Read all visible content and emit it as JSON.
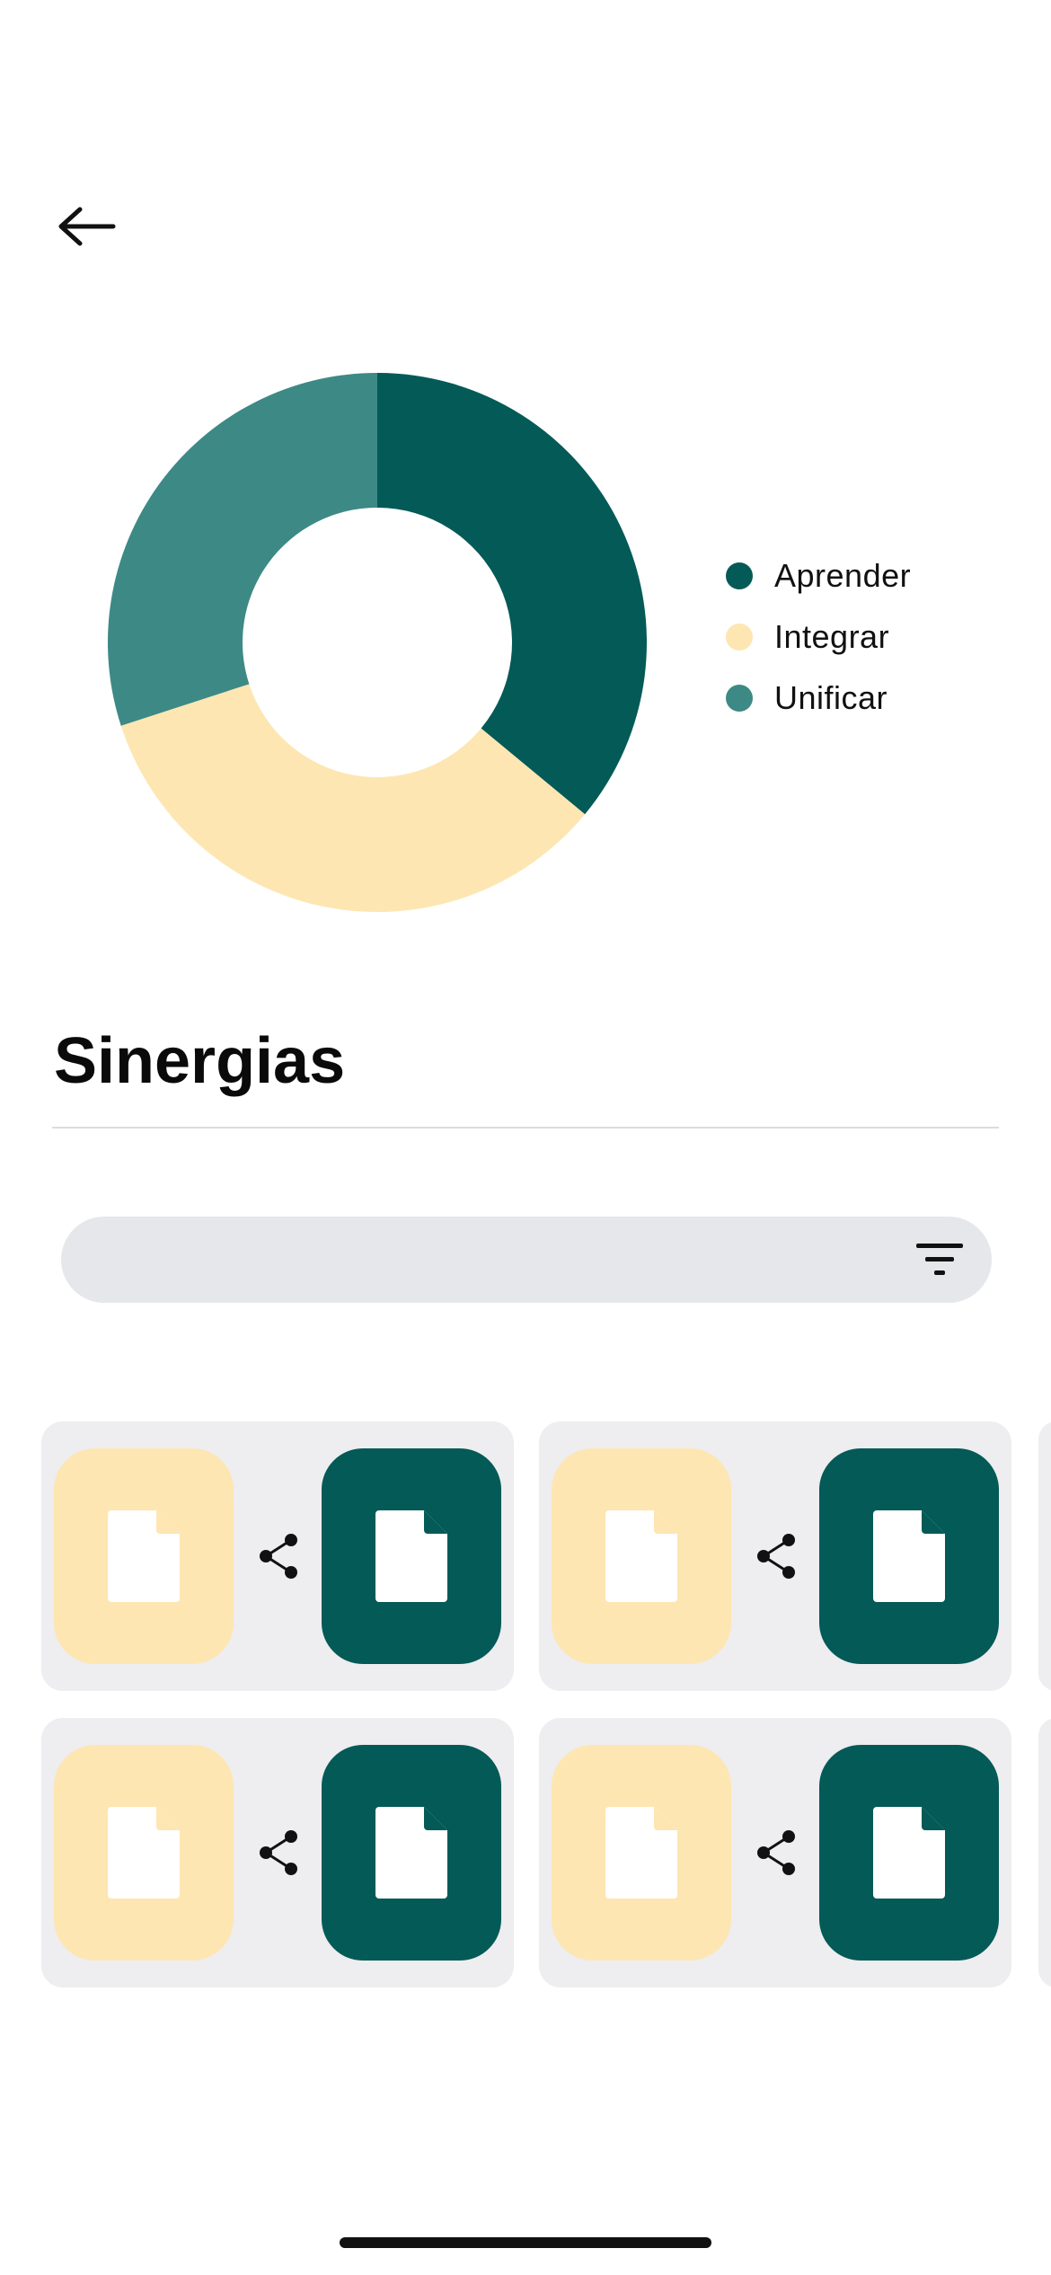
{
  "header": {
    "back_icon": "arrow-left-icon"
  },
  "chart_data": {
    "type": "pie",
    "title": "",
    "categories": [
      "Aprender",
      "Integrar",
      "Unificar"
    ],
    "values": [
      36,
      34,
      30
    ],
    "colors": [
      "#035a57",
      "#fde6b1",
      "#3d8985"
    ],
    "legend_placement": "right"
  },
  "legend": {
    "items": [
      {
        "label": "Aprender",
        "color": "#035a57"
      },
      {
        "label": "Integrar",
        "color": "#fde6b1"
      },
      {
        "label": "Unificar",
        "color": "#3d8985"
      }
    ]
  },
  "section": {
    "title": "Sinergias"
  },
  "search": {
    "value": "",
    "placeholder": "",
    "filter_icon": "filter-icon"
  },
  "cards": [
    {
      "left_color": "#fde6b1",
      "right_color": "#035a57",
      "link_icon": "share-icon"
    },
    {
      "left_color": "#fde6b1",
      "right_color": "#035a57",
      "link_icon": "share-icon"
    },
    {
      "left_color": "#fde6b1",
      "right_color": "#035a57",
      "link_icon": "share-icon"
    },
    {
      "left_color": "#fde6b1",
      "right_color": "#035a57",
      "link_icon": "share-icon"
    }
  ],
  "colors": {
    "accent_dark": "#035a57",
    "accent_light": "#fde6b1",
    "accent_mid": "#3d8985",
    "card_bg": "#eeedef",
    "search_bg": "#e6e7ea"
  }
}
